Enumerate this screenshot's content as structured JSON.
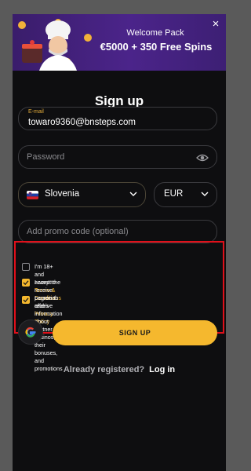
{
  "banner": {
    "kicker": "Welcome Pack",
    "headline": "€5000 + 350 Free Spins",
    "close_glyph": "×"
  },
  "form": {
    "title": "Sign up",
    "email": {
      "label": "E-mail",
      "value": "towaro9360@bnsteps.com"
    },
    "password": {
      "placeholder": "Password"
    },
    "country": {
      "value": "Slovenia",
      "flag": "slovenia-flag"
    },
    "currency": {
      "value": "EUR"
    },
    "promo": {
      "placeholder": "Add promo code (optional)"
    }
  },
  "consents": [
    {
      "checked": false,
      "prefix": "I'm 18+ and accept the ",
      "link1": "Terms & Conditions",
      "middle": " and ",
      "link2": "Privacy Policy"
    },
    {
      "checked": true,
      "text": "I want to receive personal offers"
    },
    {
      "checked": true,
      "text_line1": "I agree to receive information about partner casinos, their",
      "text_line2": "bonuses, and promotions"
    }
  ],
  "actions": {
    "google_icon": "google-icon",
    "signup_label": "SIGN UP",
    "already_registered": "Already registered?",
    "login_label": "Log in"
  },
  "colors": {
    "accent": "#f5b82e",
    "highlight_border": "#e0101a",
    "modal_bg": "#0e0e10"
  }
}
